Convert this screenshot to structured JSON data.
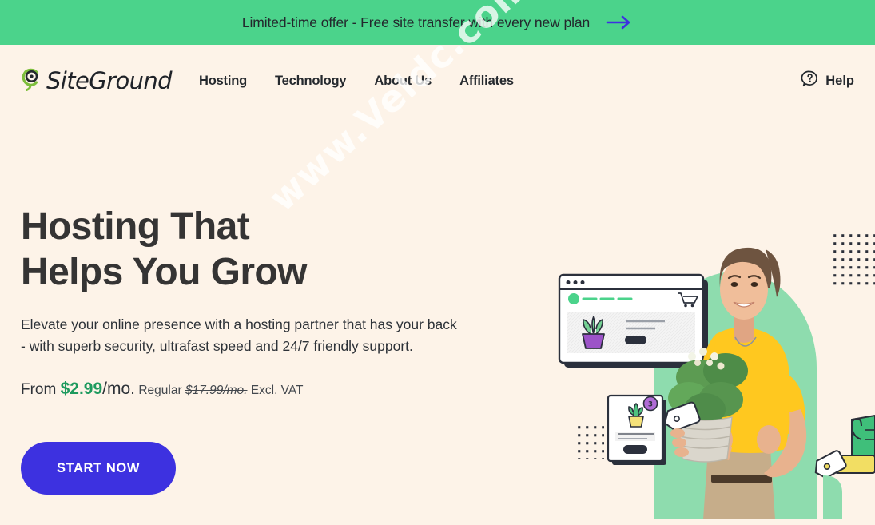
{
  "promo": {
    "text": "Limited-time offer - Free site transfer with every new plan",
    "arrow_icon": "arrow-right-icon",
    "bg_color": "#4BD38B",
    "arrow_color": "#3D31E0"
  },
  "header": {
    "logo": {
      "text": "SiteGround",
      "mark_icon": "siteground-swoosh-icon",
      "mark_color": "#7DBE3C"
    },
    "nav": [
      {
        "label": "Hosting"
      },
      {
        "label": "Technology"
      },
      {
        "label": "About Us"
      },
      {
        "label": "Affiliates"
      }
    ],
    "help": {
      "label": "Help",
      "icon": "question-bubble-icon"
    }
  },
  "hero": {
    "title": "Hosting That\nHelps You Grow",
    "subtitle": "Elevate your online presence with a hosting partner that has your back\n- with superb security, ultrafast speed and 24/7 friendly support.",
    "price": {
      "from": "From ",
      "amount": "$2.99",
      "unit": "/mo.",
      "regular_label": " Regular ",
      "regular_value": "$17.99/mo.",
      "vat": " Excl. VAT",
      "accent_color": "#1E9A5E"
    },
    "cta": {
      "label": "START NOW",
      "bg_color": "#3D31E0",
      "text_color": "#FFFFFF"
    }
  },
  "art": {
    "arch_color": "#8EDCAE",
    "browser_card": {
      "name": "browser-mockup",
      "dots": 3,
      "cart_icon": "shopping-cart-icon",
      "plant_icon": "potted-plant-icon",
      "pot_color": "#9C53C8"
    },
    "product_card": {
      "name": "product-card-mockup",
      "badge_count": "3",
      "badge_color": "#B06CD6",
      "cactus_icon": "cactus-pot-icon",
      "pot_color": "#F5E27A"
    },
    "tag_icon": "price-tag-icon",
    "cactus_icon": "cactus-icon",
    "shelf_color": "#F2DE63",
    "dot_grid_color": "#2B2F3A",
    "woman_shirt_color": "#FFC81F",
    "woman_pants_color": "#C6AD8A"
  },
  "watermark": {
    "text": "www.Veldc.com"
  }
}
